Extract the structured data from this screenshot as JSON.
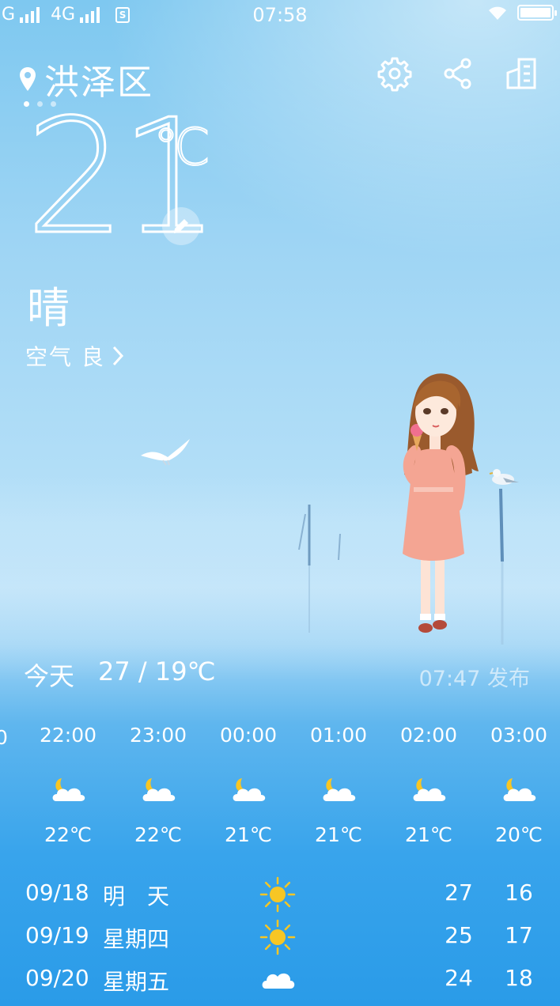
{
  "status_bar": {
    "left_text": "G",
    "network": "4G",
    "sim_label": "S",
    "time": "07:58",
    "battery_level": 1.0
  },
  "header": {
    "city": "洪泽区",
    "icons": [
      "location-pin-icon",
      "settings-icon",
      "share-icon",
      "city-manage-icon"
    ],
    "pages": 3,
    "active_page": 0
  },
  "current": {
    "temperature": "21",
    "unit": "℃",
    "condition": "晴",
    "air_quality": "空气 良"
  },
  "today": {
    "label": "今天",
    "range": "27 / 19℃",
    "published": "07:47 发布"
  },
  "hourly": [
    {
      "time": "22:00",
      "icon": "partly-cloudy-night-icon",
      "temp": "22℃"
    },
    {
      "time": "23:00",
      "icon": "partly-cloudy-night-icon",
      "temp": "22℃"
    },
    {
      "time": "00:00",
      "icon": "partly-cloudy-night-icon",
      "temp": "21℃"
    },
    {
      "time": "01:00",
      "icon": "partly-cloudy-night-icon",
      "temp": "21℃"
    },
    {
      "time": "02:00",
      "icon": "partly-cloudy-night-icon",
      "temp": "21℃"
    },
    {
      "time": "03:00",
      "icon": "partly-cloudy-night-icon",
      "temp": "20℃"
    }
  ],
  "daily": [
    {
      "date": "09/18",
      "weekday": "明 天",
      "icon": "sunny-icon",
      "high": "27",
      "low": "16"
    },
    {
      "date": "09/19",
      "weekday": "星期四",
      "icon": "sunny-icon",
      "high": "25",
      "low": "17"
    },
    {
      "date": "09/20",
      "weekday": "星期五",
      "icon": "cloudy-icon",
      "high": "24",
      "low": "18"
    }
  ]
}
